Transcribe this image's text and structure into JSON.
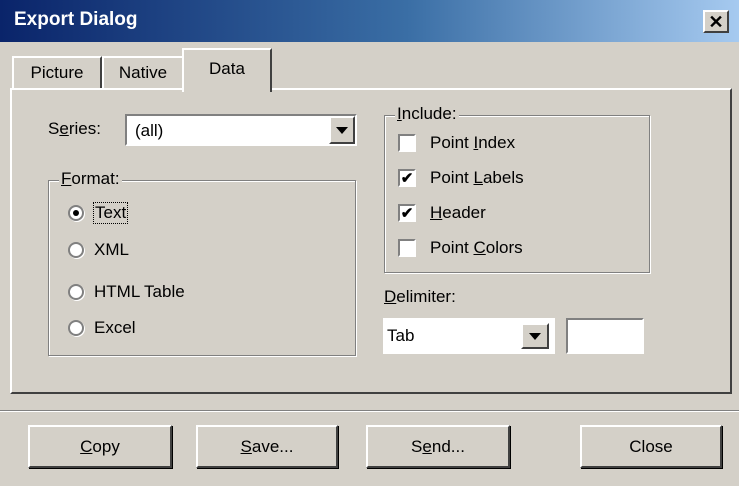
{
  "window": {
    "title": "Export Dialog",
    "close_glyph": "✕"
  },
  "tabs": [
    {
      "label": "Picture",
      "active": false
    },
    {
      "label": "Native",
      "active": false
    },
    {
      "label": "Data",
      "active": true
    }
  ],
  "series": {
    "label_pre": "S",
    "label_u": "e",
    "label_post": "ries:",
    "value": "(all)"
  },
  "format": {
    "title_u": "F",
    "title_rest": "ormat:",
    "options": [
      {
        "label": "Text",
        "selected": true
      },
      {
        "label": "XML",
        "selected": false
      },
      {
        "label": "HTML Table",
        "selected": false
      },
      {
        "label": "Excel",
        "selected": false
      }
    ]
  },
  "include": {
    "title_u": "I",
    "title_rest": "nclude:",
    "items": [
      {
        "pre": "Point ",
        "u": "I",
        "post": "ndex",
        "checked": false
      },
      {
        "pre": "Point ",
        "u": "L",
        "post": "abels",
        "checked": true
      },
      {
        "pre": "",
        "u": "H",
        "post": "eader",
        "checked": true
      },
      {
        "pre": "Point ",
        "u": "C",
        "post": "olors",
        "checked": false
      }
    ],
    "check_glyph": "✔"
  },
  "delimiter": {
    "label_u": "D",
    "label_rest": "elimiter:",
    "value": "Tab",
    "custom_value": ""
  },
  "buttons": {
    "copy": {
      "u": "C",
      "rest": "opy"
    },
    "save": {
      "u": "S",
      "rest": "ave..."
    },
    "send": {
      "pre": "S",
      "u": "e",
      "rest": "nd..."
    },
    "close": "Close"
  }
}
